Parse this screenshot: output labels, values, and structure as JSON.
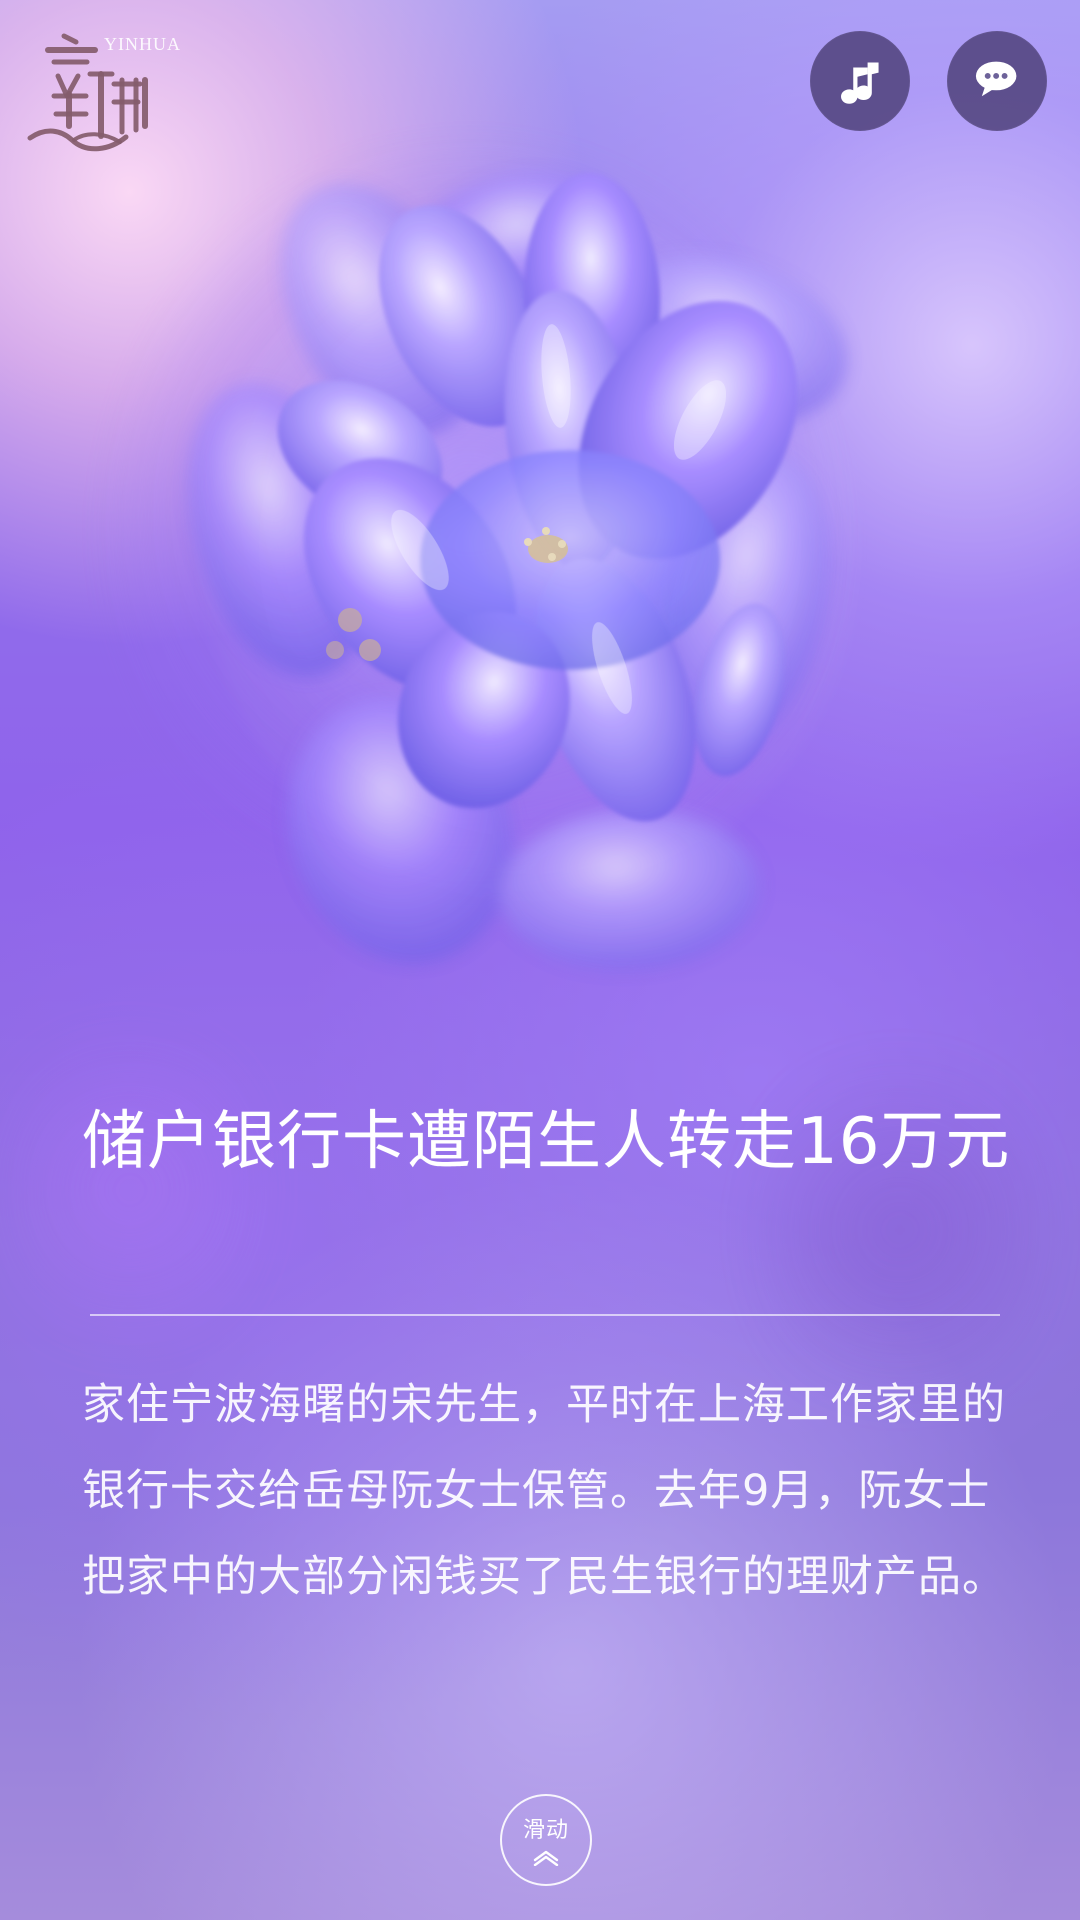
{
  "header": {
    "logo": {
      "latin_text": "YINHUA",
      "icon": "yinhua-logo-mark"
    },
    "actions": {
      "music_icon": "music-note-icon",
      "chat_icon": "chat-bubble-icon"
    }
  },
  "hero": {
    "image": "purple-hyacinth-flowers"
  },
  "article": {
    "title": "储户银行卡遭陌生人转走16万元",
    "body": "家住宁波海曙的宋先生，平时在上海工作家里的银行卡交给岳母阮女士保管。去年9月，阮女士把家中的大部分闲钱买了民生银行的理财产品。"
  },
  "footer": {
    "swipe_label": "滑动",
    "swipe_icon": "chevron-up-icon"
  },
  "colors": {
    "background_primary": "#8f63eb",
    "background_secondary": "#a59cf2",
    "button_fill": "#473a70",
    "text": "#ffffff",
    "logo": "#845c6c"
  }
}
